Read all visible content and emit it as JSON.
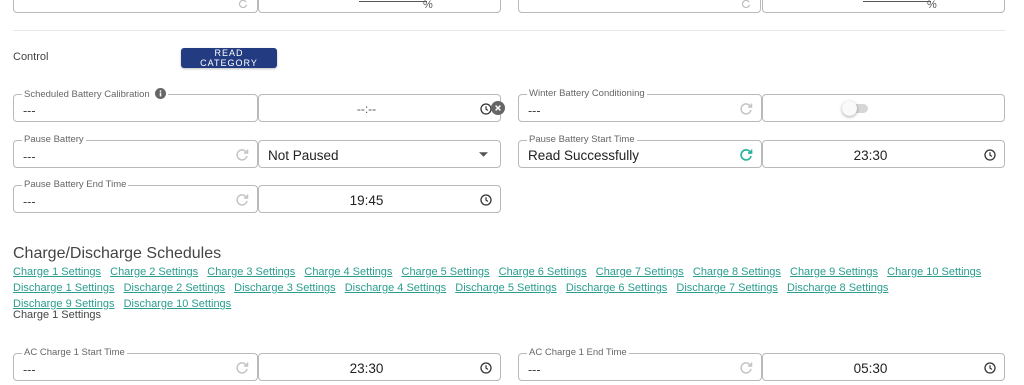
{
  "top_partial": {
    "value_tail": "%"
  },
  "control": {
    "label": "Control",
    "read_button": "READ CATEGORY"
  },
  "fields": {
    "scheduled_battery_calibration": {
      "label": "Scheduled Battery Calibration",
      "value": "---",
      "time": "--:--"
    },
    "winter_battery_conditioning": {
      "label": "Winter Battery Conditioning",
      "value": "---"
    },
    "pause_battery": {
      "label": "Pause Battery",
      "value": "---",
      "select": "Not Paused"
    },
    "pause_battery_start_time": {
      "label": "Pause Battery Start Time",
      "value": "Read Successfully",
      "time": "23:30"
    },
    "pause_battery_end_time": {
      "label": "Pause Battery End Time",
      "value": "---",
      "time": "19:45"
    },
    "ac_charge_1_start_time": {
      "label": "AC Charge 1 Start Time",
      "value": "---",
      "time": "23:30"
    },
    "ac_charge_1_end_time": {
      "label": "AC Charge 1 End Time",
      "value": "---",
      "time": "05:30"
    }
  },
  "schedules": {
    "heading": "Charge/Discharge Schedules",
    "links": [
      "Charge 1 Settings",
      "Charge 2 Settings",
      "Charge 3 Settings",
      "Charge 4 Settings",
      "Charge 5 Settings",
      "Charge 6 Settings",
      "Charge 7 Settings",
      "Charge 8 Settings",
      "Charge 9 Settings",
      "Charge 10 Settings",
      "Discharge 1 Settings",
      "Discharge 2 Settings",
      "Discharge 3 Settings",
      "Discharge 4 Settings",
      "Discharge 5 Settings",
      "Discharge 6 Settings",
      "Discharge 7 Settings",
      "Discharge 8 Settings",
      "Discharge 9 Settings",
      "Discharge 10 Settings"
    ],
    "subheading": "Charge 1 Settings"
  },
  "colors": {
    "primary_button": "#233b80",
    "link": "#2a9d8f",
    "success_icon": "#2bb39a"
  },
  "icons": {
    "info": "info-icon",
    "refresh": "refresh-icon",
    "clock": "clock-icon",
    "clear": "clear-icon",
    "dropdown": "caret-down-icon"
  }
}
